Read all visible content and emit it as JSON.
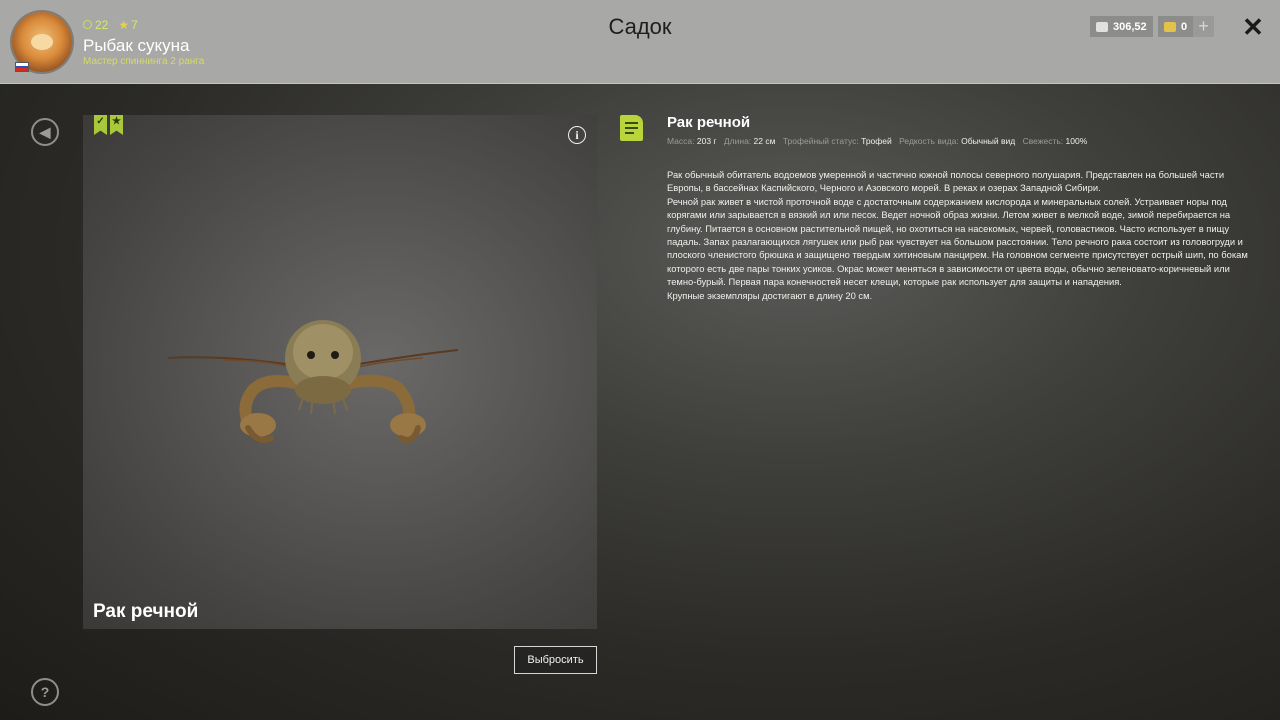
{
  "header": {
    "title": "Садок",
    "player": {
      "name": "Рыбак сукуна",
      "rank": "Мастер спиннинга 2 ранга",
      "stat_level": "22",
      "stat_stars": "7",
      "flag": "ru"
    },
    "currency": {
      "silver": "306,52",
      "gold": "0"
    },
    "icons": {
      "close": "close-icon",
      "add": "plus-icon"
    }
  },
  "sidebar": {
    "back_icon": "back-arrow-icon",
    "help_icon": "help-icon"
  },
  "viewer": {
    "fish_name": "Рак речной",
    "badges": [
      "check-bookmark-icon",
      "star-bookmark-icon"
    ],
    "info_icon": "info-icon"
  },
  "actions": {
    "drop_label": "Выбросить"
  },
  "details": {
    "title": "Рак речной",
    "meta": [
      {
        "label": "Масса:",
        "value": "203 г"
      },
      {
        "label": "Длина:",
        "value": "22 см"
      },
      {
        "label": "Трофейный статус:",
        "value": "Трофей"
      },
      {
        "label": "Редкость вида:",
        "value": "Обычный вид"
      },
      {
        "label": "Свежесть:",
        "value": "100%"
      }
    ],
    "description": [
      "Рак обычный обитатель водоемов умеренной и частично южной полосы северного полушария. Представлен на большей части Европы, в бассейнах Каспийского, Черного и Азовского морей. В реках и озерах Западной Сибири.",
      "Речной рак живет в чистой проточной воде с достаточным содержанием кислорода и минеральных солей. Устраивает норы под корягами или зарывается в вязкий ил или песок. Ведет ночной образ жизни. Летом живет в мелкой воде, зимой перебирается на глубину. Питается в основном растительной пищей, но охотиться на насекомых, червей, головастиков. Часто использует в пищу падаль. Запах разлагающихся лягушек или рыб рак чувствует на большом расстоянии. Тело речного рака состоит из головогруди и плоского членистого брюшка и защищено твердым хитиновым панцирем. На головном сегменте присутствует острый шип, по бокам которого есть две пары тонких усиков. Окрас может меняться в зависимости от цвета воды, обычно зеленовато-коричневый или темно-бурый. Первая пара конечностей несет клещи, которые рак использует для защиты и нападения.",
      "Крупные экземпляры достигают в длину 20 см."
    ]
  },
  "colors": {
    "accent": "#b8d63c",
    "topbar": "#a8a8a6",
    "rank_text": "#d2dc62"
  }
}
